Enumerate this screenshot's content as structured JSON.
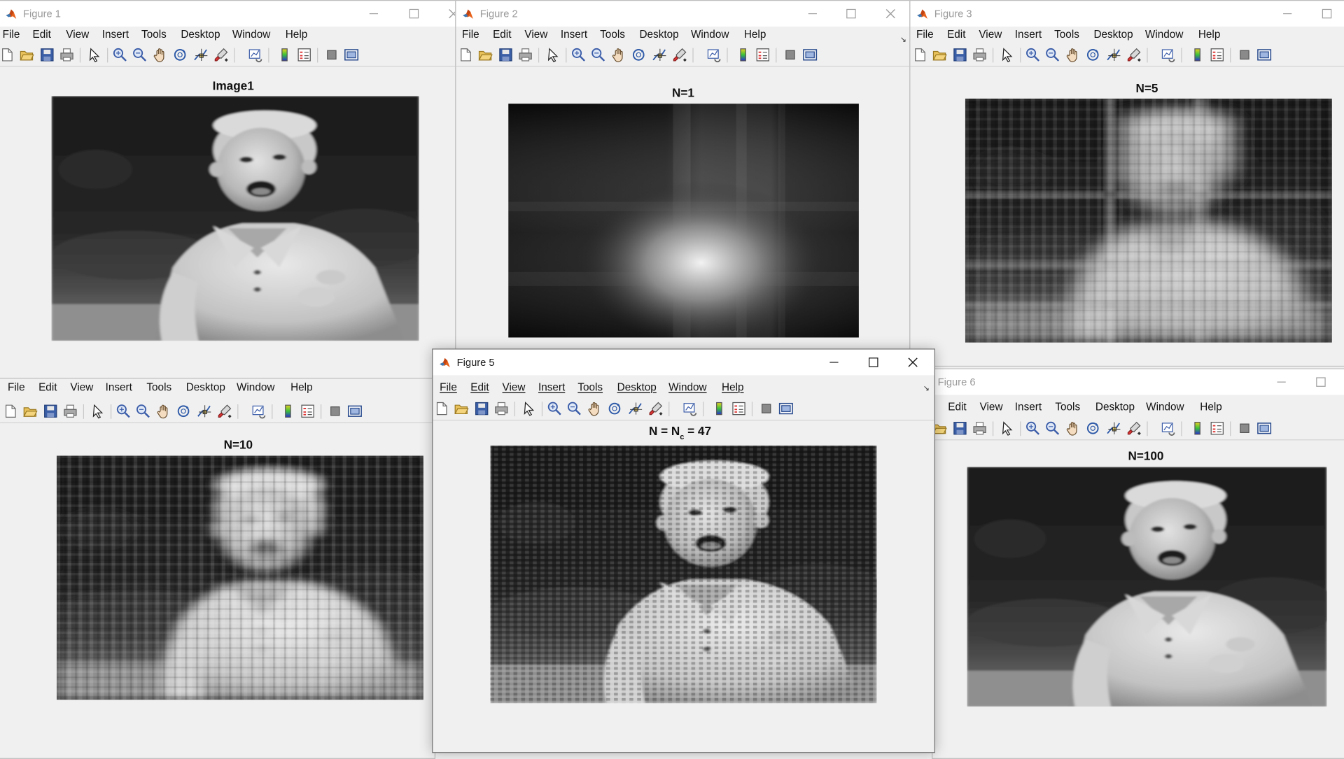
{
  "menu": [
    "File",
    "Edit",
    "View",
    "Insert",
    "Tools",
    "Desktop",
    "Window",
    "Help"
  ],
  "figures": {
    "f1": {
      "window_title": "Figure 1",
      "plot_title": "Image1"
    },
    "f2": {
      "window_title": "Figure 2",
      "plot_title": "N=1"
    },
    "f3": {
      "window_title": "Figure 3",
      "plot_title": "N=5"
    },
    "f4": {
      "window_title": "",
      "plot_title": "N=10"
    },
    "f5": {
      "window_title": "Figure 5",
      "plot_title_main": "N = N",
      "plot_title_sub": "c",
      "plot_title_rest": " = 47"
    },
    "f6": {
      "window_title": "Figure 6",
      "plot_title": "N=100"
    }
  },
  "toolbar_icons": [
    "new-figure-icon",
    "open-file-icon",
    "save-icon",
    "print-icon",
    "select-arrow-icon",
    "zoom-in-icon",
    "zoom-out-icon",
    "pan-hand-icon",
    "rotate-3d-icon",
    "data-cursor-icon",
    "brush-icon",
    "link-plot-icon",
    "colorbar-icon",
    "legend-icon",
    "hide-plot-tools-icon",
    "show-plot-tools-icon"
  ],
  "colors": {
    "window_bg": "#f0f0f0",
    "titlebar_bg": "#ffffff",
    "accent_matlab": "#e8611a"
  }
}
